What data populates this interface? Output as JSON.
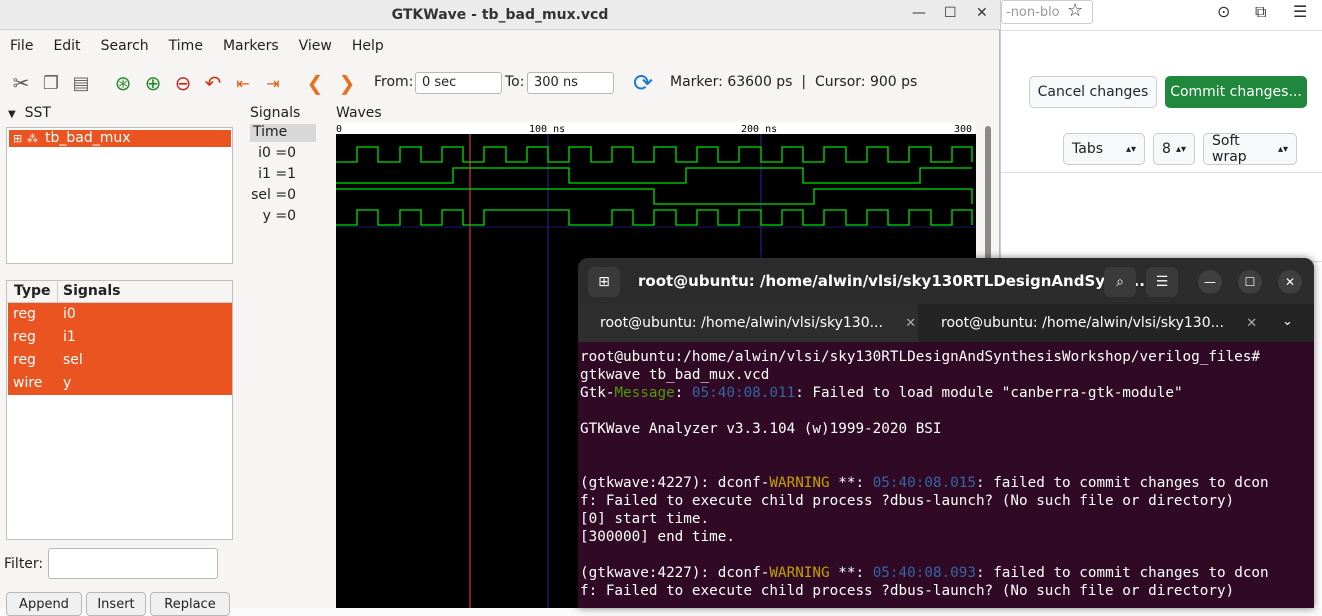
{
  "browser": {
    "url_fragment": "-non-blo",
    "cancel_label": "Cancel changes",
    "commit_label": "Commit changes...",
    "indent_mode": "Tabs",
    "indent_size": "8",
    "wrap_mode": "Soft wrap",
    "colors": {
      "commit": "#1f883d"
    }
  },
  "gtkwave": {
    "title": "GTKWave - tb_bad_mux.vcd",
    "menu": [
      "File",
      "Edit",
      "Search",
      "Time",
      "Markers",
      "View",
      "Help"
    ],
    "toolbar": {
      "from_label": "From:",
      "from_value": "0 sec",
      "to_label": "To:",
      "to_value": "300 ns",
      "marker_text": "Marker: 63600 ps  |  Cursor: 900 ps"
    },
    "sst": {
      "label": "SST",
      "tree_item": "tb_bad_mux",
      "table_headers": [
        "Type",
        "Signals"
      ],
      "rows": [
        {
          "type": "reg",
          "signal": "i0"
        },
        {
          "type": "reg",
          "signal": "i1"
        },
        {
          "type": "reg",
          "signal": "sel"
        },
        {
          "type": "wire",
          "signal": "y"
        }
      ],
      "filter_label": "Filter:",
      "buttons": [
        "Append",
        "Insert",
        "Replace"
      ]
    },
    "signals": {
      "label": "Signals",
      "time_header": "Time",
      "items": [
        "i0 =0",
        "i1 =1",
        "sel =0",
        "y =0"
      ]
    },
    "waves": {
      "label": "Waves",
      "ticks": [
        "0",
        "100 ns",
        "200 ns",
        "300"
      ],
      "colors": {
        "wave": "#00e000",
        "cursor": "#ff4040",
        "grid": "#2828a0"
      }
    }
  },
  "terminal": {
    "title": "root@ubuntu: /home/alwin/vlsi/sky130RTLDesignAndSynth...",
    "tabs": [
      "root@ubuntu: /home/alwin/vlsi/sky130...",
      "root@ubuntu: /home/alwin/vlsi/sky130..."
    ],
    "lines": [
      "root@ubuntu:/home/alwin/vlsi/sky130RTLDesignAndSynthesisWorkshop/verilog_files#",
      "gtkwave tb_bad_mux.vcd",
      "Gtk-Message: 05:40:08.011: Failed to load module \"canberra-gtk-module\"",
      "",
      "GTKWave Analyzer v3.3.104 (w)1999-2020 BSI",
      "",
      "",
      "(gtkwave:4227): dconf-WARNING **: 05:40:08.015: failed to commit changes to dcon",
      "f: Failed to execute child process ?dbus-launch? (No such file or directory)",
      "[0] start time.",
      "[300000] end time.",
      "",
      "(gtkwave:4227): dconf-WARNING **: 05:40:08.093: failed to commit changes to dcon",
      "f: Failed to execute child process ?dbus-launch? (No such file or directory)"
    ]
  }
}
